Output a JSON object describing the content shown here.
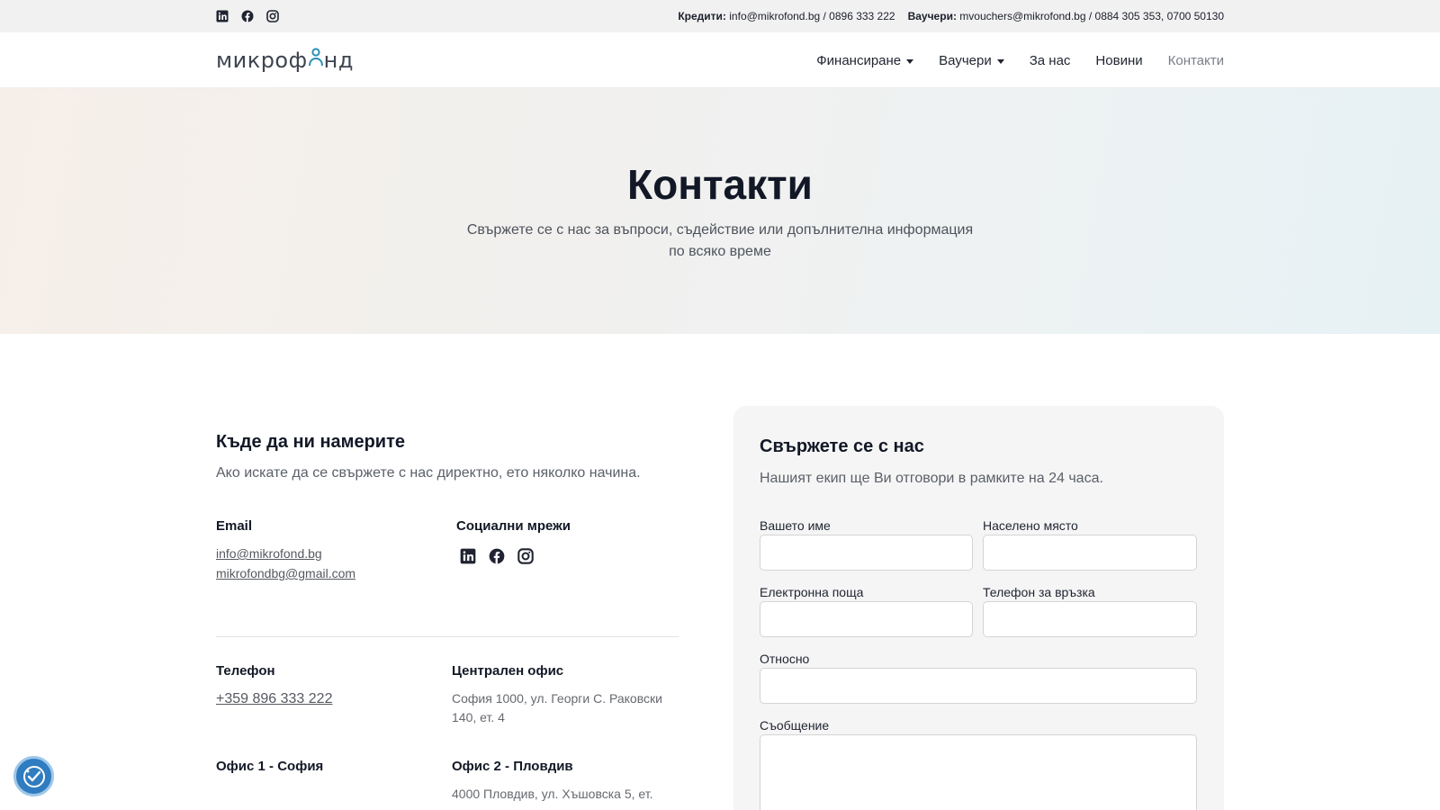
{
  "topbar": {
    "credits_label": "Кредити:",
    "credits_value": "info@mikrofond.bg / 0896 333 222",
    "vouchers_label": "Ваучери:",
    "vouchers_value": "mvouchers@mikrofond.bg / 0884 305 353, 0700 50130",
    "social_icons": [
      "linkedin-icon",
      "facebook-icon",
      "instagram-icon"
    ]
  },
  "header": {
    "logo_text_a": "микроф",
    "logo_text_b": "нд",
    "nav": [
      {
        "label": "Финансиране",
        "dropdown": true
      },
      {
        "label": "Ваучери",
        "dropdown": true
      },
      {
        "label": "За нас",
        "dropdown": false
      },
      {
        "label": "Новини",
        "dropdown": false
      },
      {
        "label": "Контакти",
        "dropdown": false,
        "active": true
      }
    ]
  },
  "hero": {
    "title": "Контакти",
    "subtitle": "Свържете се с нас за въпроси, съдействие или допълнителна информация по всяко време"
  },
  "where": {
    "title": "Къде да ни намерите",
    "lead": "Ако искате да се свържете с нас директно, ето няколко начина.",
    "email_title": "Email",
    "emails": [
      "info@mikrofond.bg",
      "mikrofondbg@gmail.com"
    ],
    "social_title": "Социални мрежи",
    "phone_title": "Телефон",
    "phone": "+359 896 333 222",
    "central_title": "Централен офис",
    "central_addr": "София 1000, ул. Георги С. Раковски 140, ет. 4",
    "office1_title": "Офис 1 - София",
    "office2_title": "Офис 2 - Пловдив",
    "office2_addr": "4000 Пловдив, ул. Хъшовска 5, ет."
  },
  "form": {
    "title": "Свържете се с нас",
    "subtitle": "Нашият екип ще Ви отговори в рамките на 24 часа.",
    "name_label": "Вашето име",
    "city_label": "Населено място",
    "email_label": "Електронна поща",
    "phone_label": "Телефон за връзка",
    "about_label": "Относно",
    "message_label": "Съобщение"
  },
  "colors": {
    "accent": "#2b8fb3",
    "a11y_button": "#2f7cc0"
  }
}
